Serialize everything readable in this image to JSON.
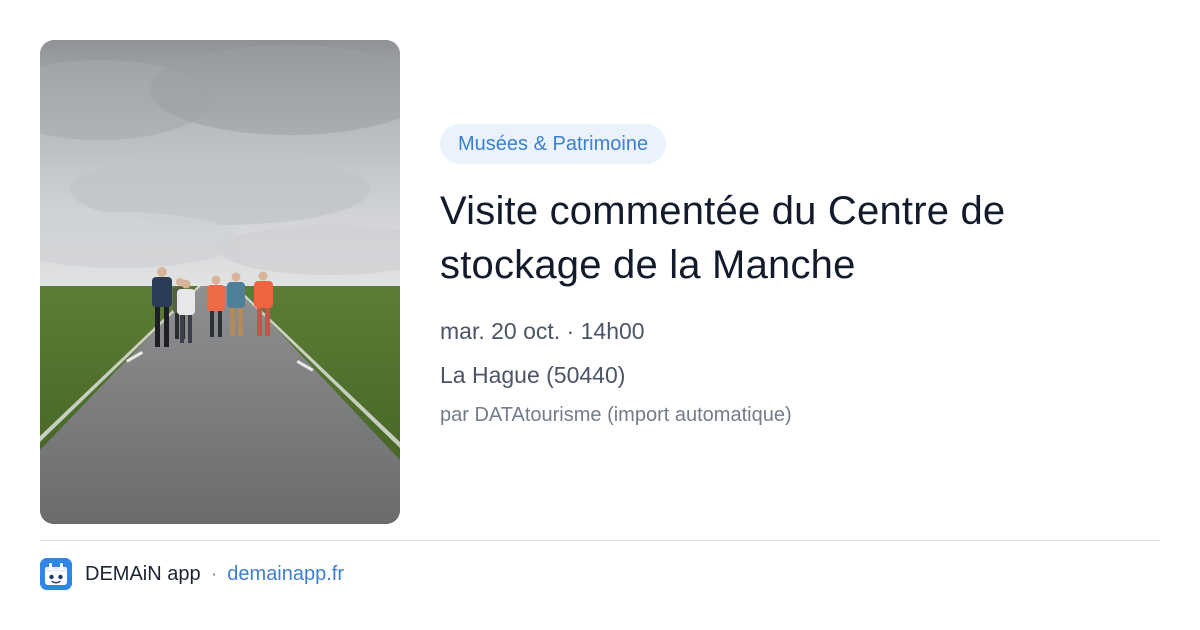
{
  "event": {
    "category": "Musées & Patrimoine",
    "title": "Visite commentée du Centre de stockage de la Manche",
    "date": "mar. 20 oct. · 14h00",
    "location": "La Hague (50440)",
    "source": "par DATAtourisme (import automatique)"
  },
  "photo": {
    "subject": "event-photo",
    "colors": {
      "sky": "#c4c7ca",
      "grass": "#4b6b2c",
      "road": "#77787a"
    }
  },
  "footer": {
    "app_name": "DEMAiN app",
    "separator": "·",
    "url": "demainapp.fr",
    "logo_icon": "demain-app-logo-icon"
  },
  "colors": {
    "accent": "#3d7fd0",
    "badge_bg": "#eaf2fc",
    "title": "#121b2c",
    "meta": "#4b5566",
    "muted": "#727c8b",
    "logo_bg": "#2f86e6"
  }
}
